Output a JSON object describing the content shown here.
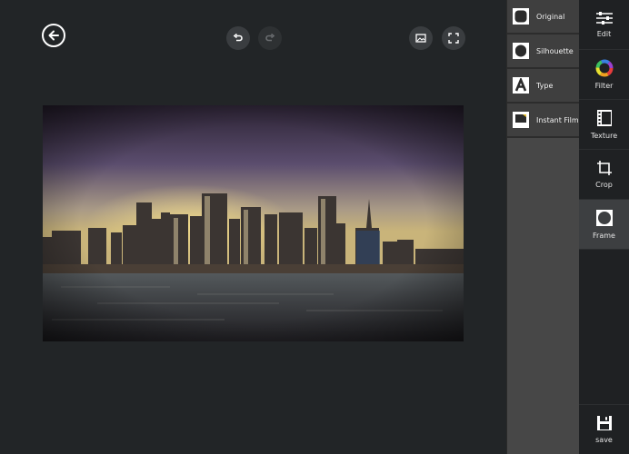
{
  "frames": [
    {
      "label": "Original",
      "icon": "original-frame-icon"
    },
    {
      "label": "Silhouette",
      "icon": "silhouette-frame-icon"
    },
    {
      "label": "Type",
      "icon": "type-frame-icon"
    },
    {
      "label": "Instant Film",
      "icon": "instant-film-frame-icon"
    }
  ],
  "tools": [
    {
      "label": "Edit",
      "icon": "sliders-icon"
    },
    {
      "label": "Filter",
      "icon": "color-wheel-icon"
    },
    {
      "label": "Texture",
      "icon": "film-strip-icon"
    },
    {
      "label": "Crop",
      "icon": "crop-icon"
    },
    {
      "label": "Frame",
      "icon": "frame-circle-icon"
    }
  ],
  "save_label": "save",
  "active_tool": "Frame",
  "colors": {
    "accent_filter": "#e63",
    "panel": "#474747",
    "toolbar": "#1f2123"
  }
}
